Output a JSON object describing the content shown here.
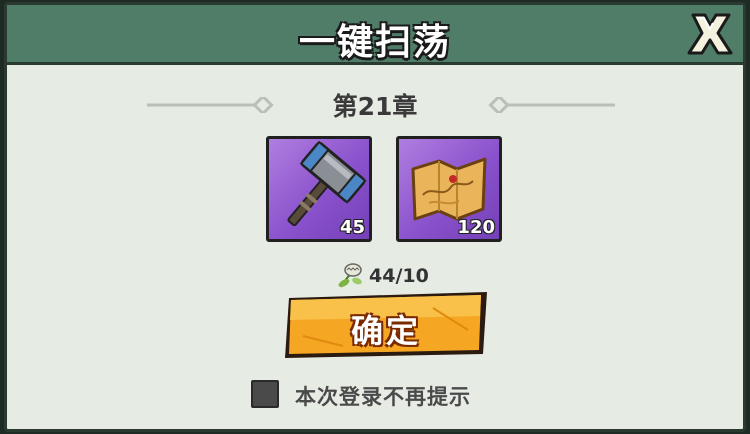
{
  "dialog": {
    "title": "一键扫荡",
    "close_icon": "close-x-icon",
    "chapter": "第21章",
    "rewards": [
      {
        "icon": "hammer-icon",
        "count": "45"
      },
      {
        "icon": "treasure-map-icon",
        "count": "120"
      }
    ],
    "stamina": {
      "icon": "stamina-plant-icon",
      "value": "44/10"
    },
    "confirm_label": "确定",
    "dont_show_label": "本次登录不再提示",
    "colors": {
      "header": "#4f7d68",
      "panel": "#e6ebe4",
      "reward_bg": "#8a52cc",
      "button": "#f5a623",
      "checkbox": "#4a4a4a"
    }
  }
}
